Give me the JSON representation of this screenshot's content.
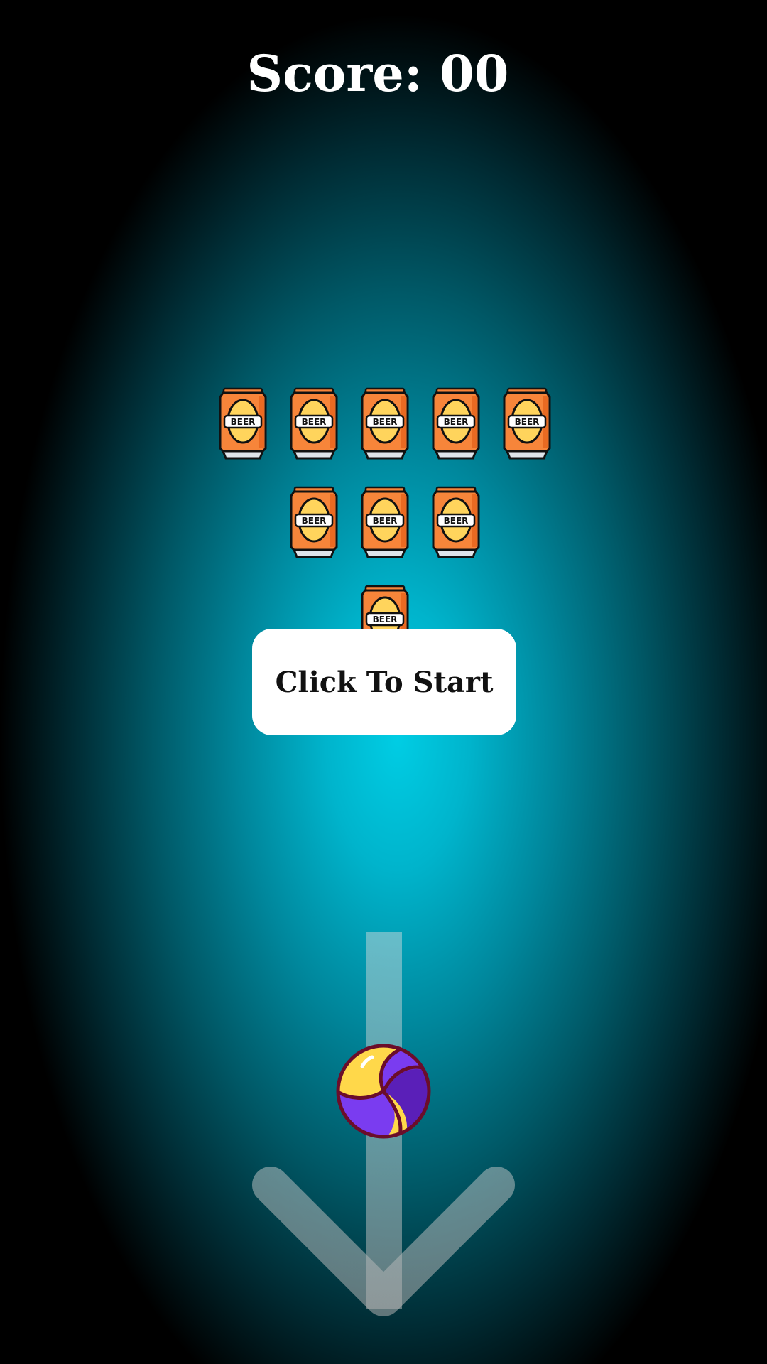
{
  "hud": {
    "score_label": "Score: 00"
  },
  "start_button": {
    "label": "Click To Start"
  },
  "cans": {
    "label": "BEER",
    "rows": [
      5,
      3,
      1
    ]
  },
  "colors": {
    "background_glow": "#00cde4",
    "can_body": "#f7853a",
    "can_label": "#ffd45c",
    "button_bg": "#ffffff",
    "ball_purple": "#7a3cf0",
    "ball_yellow": "#ffd84a",
    "aim_arrow": "#b8c8cc"
  },
  "icons": {
    "can": "beer-can-icon",
    "ball": "volleyball-icon",
    "aim": "aim-arrow-icon"
  }
}
